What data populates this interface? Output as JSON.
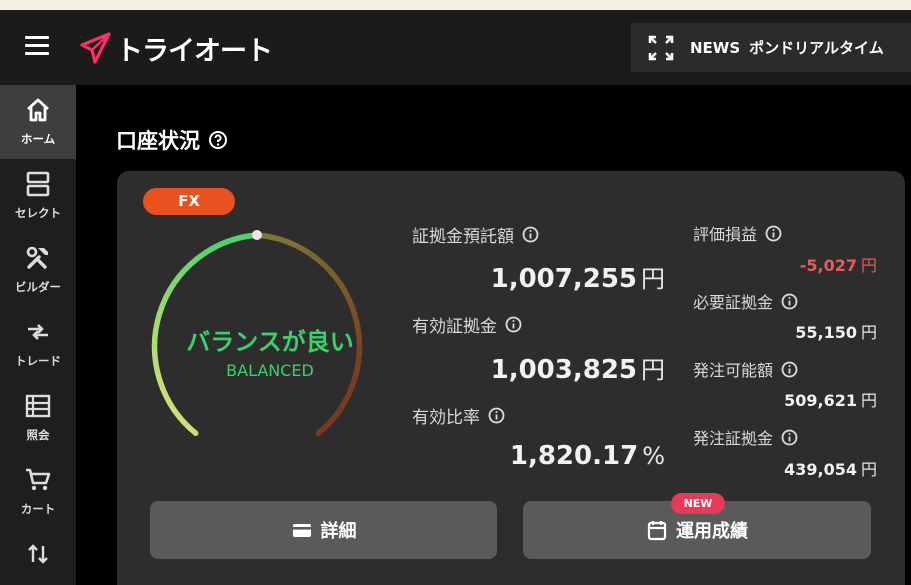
{
  "header": {
    "logo_text": "トライオート",
    "news_label": "NEWS",
    "news_text": "ポンドリアルタイム"
  },
  "sidebar": {
    "items": [
      {
        "label": "ホーム",
        "icon": "home-icon"
      },
      {
        "label": "セレクト",
        "icon": "select-icon"
      },
      {
        "label": "ビルダー",
        "icon": "builder-icon"
      },
      {
        "label": "トレード",
        "icon": "trade-icon"
      },
      {
        "label": "照会",
        "icon": "list-icon"
      },
      {
        "label": "カート",
        "icon": "cart-icon"
      }
    ]
  },
  "account": {
    "title": "口座状況",
    "badge": "FX",
    "status_ja": "バランスが良い",
    "status_en": "BALANCED",
    "metrics": [
      {
        "label": "証拠金預託額",
        "value": "1,007,255",
        "unit": "円"
      },
      {
        "label": "有効証拠金",
        "value": "1,003,825",
        "unit": "円"
      },
      {
        "label": "有効比率",
        "value": "1,820.17",
        "unit": "%"
      }
    ],
    "side_metrics": [
      {
        "label": "評価損益",
        "value": "-5,027",
        "unit": "円"
      },
      {
        "label": "必要証拠金",
        "value": "55,150",
        "unit": "円"
      },
      {
        "label": "発注可能額",
        "value": "509,621",
        "unit": "円"
      },
      {
        "label": "発注証拠金",
        "value": "439,054",
        "unit": "円"
      }
    ],
    "buttons": {
      "detail": "詳細",
      "performance": "運用成績",
      "new_badge": "NEW"
    }
  },
  "colors": {
    "accent": "#e9521f",
    "balanced": "#3ad16a",
    "negative": "#e95a5a",
    "new_badge": "#e53a5a"
  }
}
